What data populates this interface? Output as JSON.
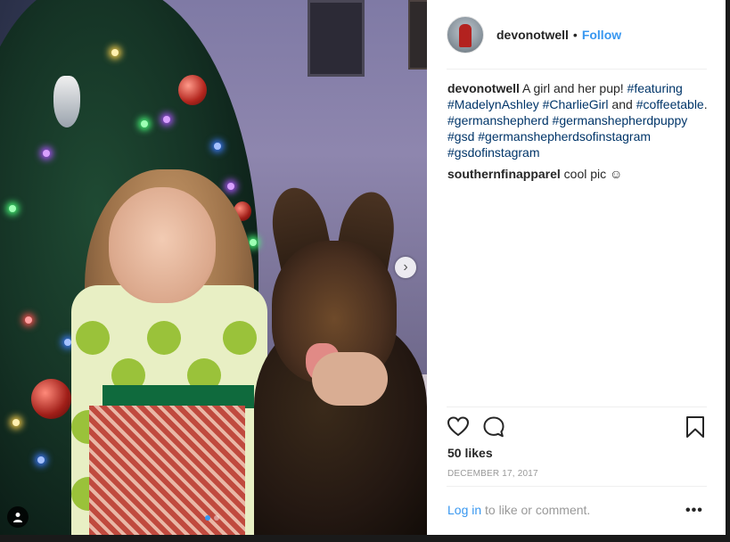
{
  "post": {
    "username": "devonotwell",
    "follow_label": "Follow",
    "bullet": "•",
    "caption": {
      "author": "devonotwell",
      "text": " A girl and her pup! ",
      "tags": [
        "#featuring",
        "#MadelynAshley",
        "#CharlieGirl",
        "#coffeetable",
        "#germanshepherd",
        "#germanshepherdpuppy",
        "#gsd",
        "#germanshepherdsofinstagram",
        "#gsdofinstagram"
      ],
      "connector_and": " and ",
      "connector_period": ". "
    },
    "comments": [
      {
        "author": "southernfinapparel",
        "text": " cool pic ☺"
      }
    ],
    "likes": "50 likes",
    "date": "DECEMBER 17, 2017",
    "login_link": "Log in",
    "login_suffix": " to like or comment.",
    "more_label": "•••"
  },
  "carousel": {
    "slide_count": 2,
    "active_index": 0,
    "next_arrow": "›"
  },
  "colors": {
    "accent": "#3897f0",
    "hashtag": "#003569",
    "text": "#262626",
    "muted": "#999999"
  },
  "icons": {
    "like": "heart-icon",
    "comment": "comment-icon",
    "save": "bookmark-icon",
    "tag": "user-tag-icon"
  }
}
